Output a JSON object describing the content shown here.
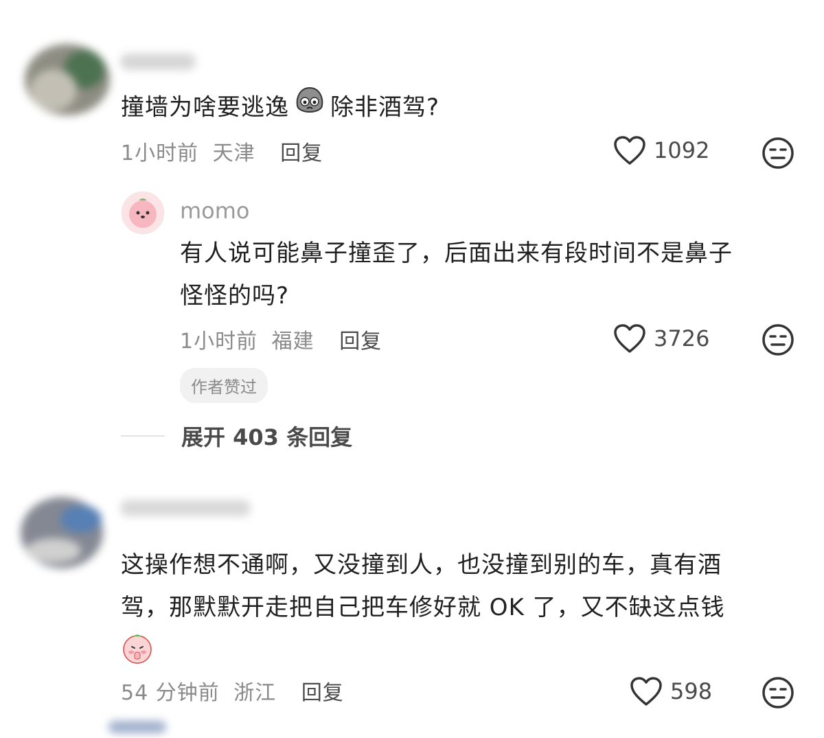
{
  "comments": [
    {
      "text_a": "撞墙为啥要逃逸",
      "text_b": "除非酒驾?",
      "time": "1小时前",
      "location": "天津",
      "reply_label": "回复",
      "likes": "1092"
    },
    {
      "username": "momo",
      "text_line1": "有人说可能鼻子撞歪了，后面出来有段时间不是鼻子",
      "text_line2": "怪怪的吗?",
      "time": "1小时前",
      "location": "福建",
      "reply_label": "回复",
      "likes": "3726",
      "tag": "作者赞过"
    },
    {
      "text_line1": "这操作想不通啊，又没撞到人，也没撞到别的车，真有酒",
      "text_line2": "驾，那默默开走把自己把车修好就 OK 了，又不缺这点钱",
      "time": "54 分钟前",
      "location": "浙江",
      "reply_label": "回复",
      "likes": "598"
    }
  ],
  "expand_replies": "展开 403 条回复",
  "icons": {
    "like": "heart-outline-icon",
    "dislike": "meh-face-icon"
  }
}
